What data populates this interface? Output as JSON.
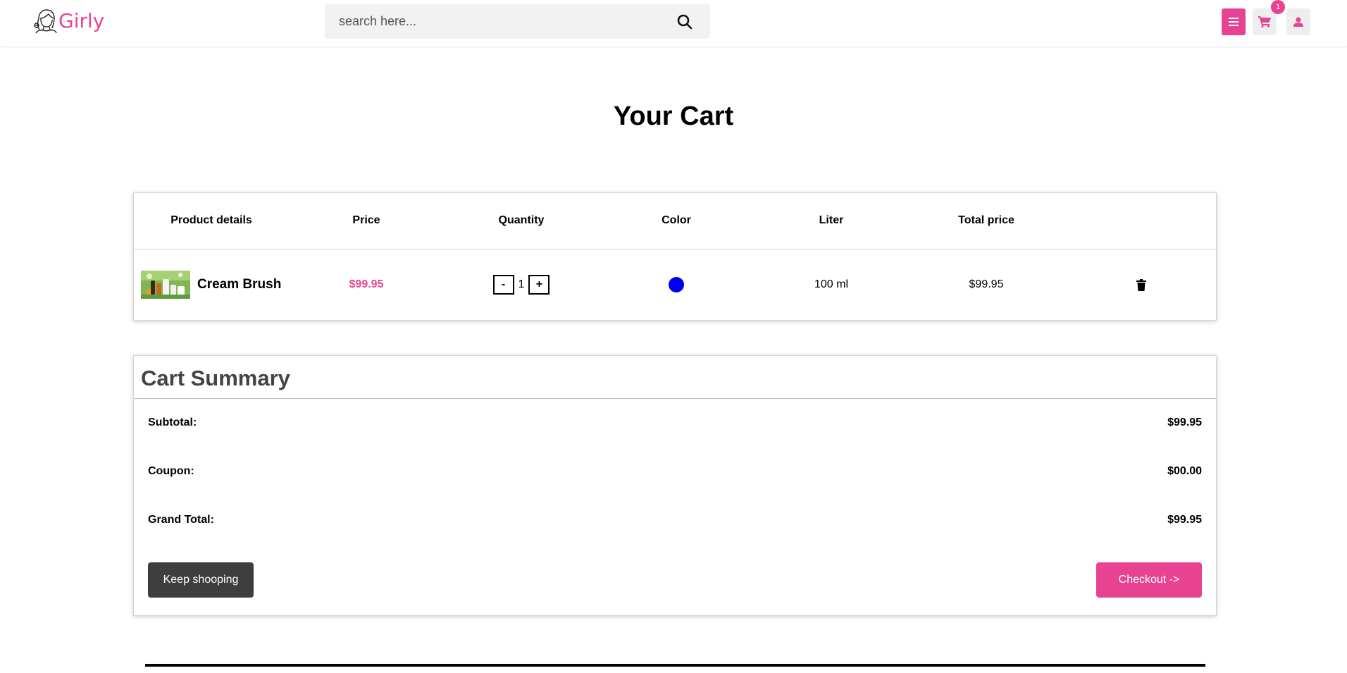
{
  "header": {
    "logo_text": "Girly",
    "search_placeholder": "search here...",
    "cart_count": "1",
    "accent_color": "#e84393"
  },
  "page": {
    "title": "Your Cart"
  },
  "cart_table": {
    "columns": [
      "Product details",
      "Price",
      "Quantity",
      "Color",
      "Liter",
      "Total price"
    ],
    "items": [
      {
        "name": "Cream Brush",
        "price": "$99.95",
        "qty_minus": "-",
        "quantity": "1",
        "qty_plus": "+",
        "color": "#0000ee",
        "liter": "100 ml",
        "total": "$99.95"
      }
    ]
  },
  "summary": {
    "title": "Cart Summary",
    "subtotal_label": "Subtotal:",
    "subtotal_value": "$99.95",
    "coupon_label": "Coupon:",
    "coupon_value": "$00.00",
    "grand_label": "Grand Total:",
    "grand_value": "$99.95",
    "keep_label": "Keep shooping",
    "checkout_label": "Checkout ->"
  },
  "icons": {
    "logo": "girl-face-icon",
    "search": "search-icon",
    "menu": "menu-icon",
    "cart": "cart-icon",
    "user": "user-icon",
    "delete": "trash-icon"
  }
}
